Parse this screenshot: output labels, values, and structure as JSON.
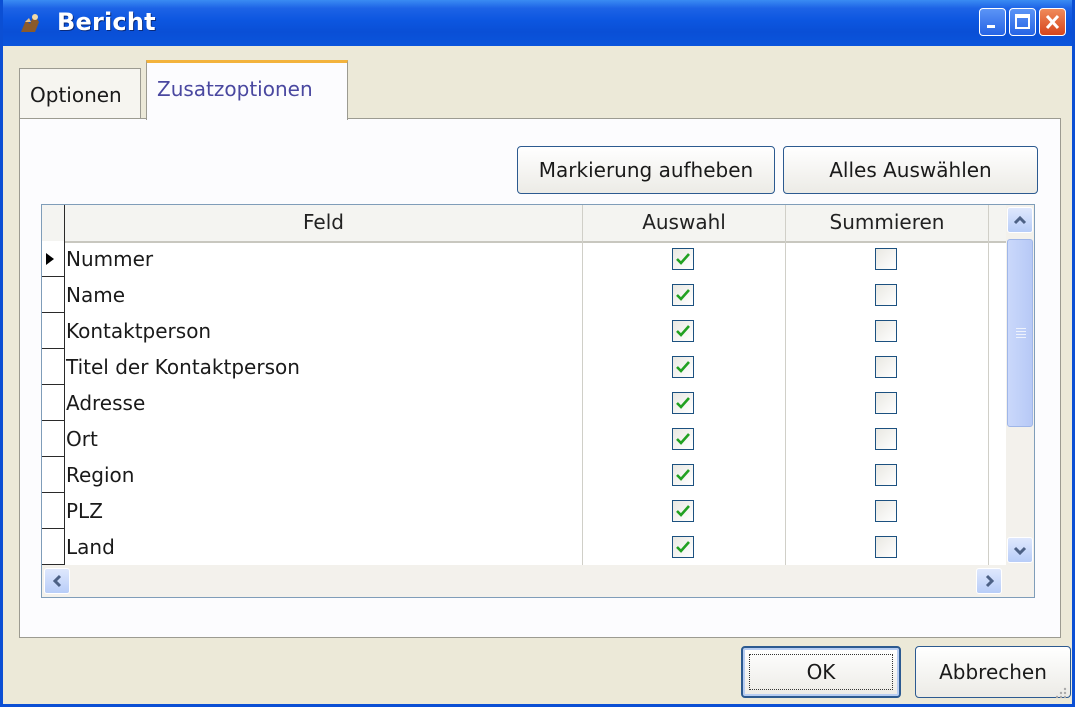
{
  "window": {
    "title": "Bericht"
  },
  "tabs": [
    {
      "label": "Optionen",
      "active": false
    },
    {
      "label": "Zusatzoptionen",
      "active": true
    }
  ],
  "toolbar": {
    "deselect_label": "Markierung aufheben",
    "select_all_label": "Alles Auswählen"
  },
  "grid": {
    "columns": [
      "Feld",
      "Auswahl",
      "Summieren"
    ],
    "rows": [
      {
        "field": "Nummer",
        "auswahl": true,
        "summieren": false
      },
      {
        "field": "Name",
        "auswahl": true,
        "summieren": false
      },
      {
        "field": "Kontaktperson",
        "auswahl": true,
        "summieren": false
      },
      {
        "field": "Titel der Kontaktperson",
        "auswahl": true,
        "summieren": false
      },
      {
        "field": "Adresse",
        "auswahl": true,
        "summieren": false
      },
      {
        "field": "Ort",
        "auswahl": true,
        "summieren": false
      },
      {
        "field": "Region",
        "auswahl": true,
        "summieren": false
      },
      {
        "field": "PLZ",
        "auswahl": true,
        "summieren": false
      },
      {
        "field": "Land",
        "auswahl": true,
        "summieren": false
      }
    ],
    "current_row": 0
  },
  "footer": {
    "ok_label": "OK",
    "cancel_label": "Abbrechen"
  },
  "colors": {
    "titlebar": "#0a4fd6",
    "check": "#21a121",
    "active_tab_accent": "#f3b33c"
  }
}
